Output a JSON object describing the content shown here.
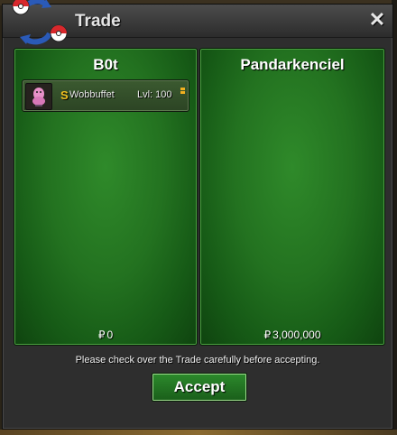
{
  "window": {
    "title": "Trade",
    "close_icon": "close-icon",
    "logo_icon": "trade-pokeball-logo-icon"
  },
  "left_panel": {
    "player_name": "B0t",
    "items": [
      {
        "icon": "wobbuffet-sprite-icon",
        "shiny_badge": "S",
        "name": "Wobbuffet",
        "level": "Lvl: 100",
        "tag_icon": "item-indicator-icon"
      }
    ],
    "currency_icon": "₽",
    "money": "0"
  },
  "right_panel": {
    "player_name": "Pandarkenciel",
    "items": [],
    "currency_icon": "₽",
    "money": "3,000,000"
  },
  "notice": "Please check over the Trade carefully before accepting.",
  "accept_label": "Accept",
  "colors": {
    "panel_green": "#237220",
    "shiny_gold": "#f0c020",
    "titlebar": "#3a3a3a"
  }
}
